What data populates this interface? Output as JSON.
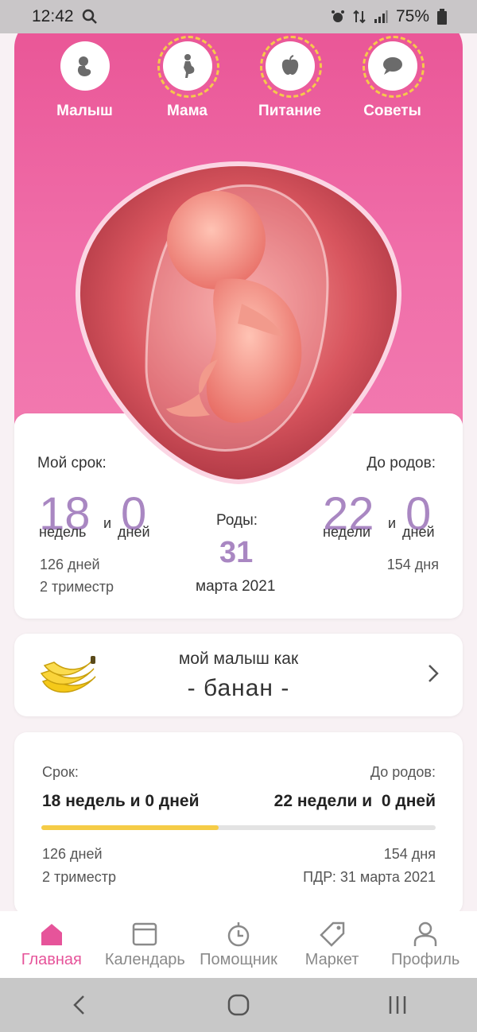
{
  "status_bar": {
    "time": "12:42",
    "battery": "75%"
  },
  "top_nav": [
    {
      "label": "Малыш",
      "icon": "baby-icon"
    },
    {
      "label": "Мама",
      "icon": "mother-icon"
    },
    {
      "label": "Питание",
      "icon": "apple-icon"
    },
    {
      "label": "Советы",
      "icon": "chat-bubble-icon"
    }
  ],
  "term": {
    "my_term_label": "Мой срок:",
    "weeks": "18",
    "weeks_word": "недель",
    "and": "и",
    "days": "0",
    "days_word": "дней",
    "total_days": "126 дней",
    "trimester": "2 триместр",
    "birth_label": "Роды:",
    "birth_day": "31",
    "birth_month": "марта 2021",
    "until_label": "До родов:",
    "until_weeks": "22",
    "until_weeks_word": "недели",
    "until_and": "и",
    "until_days": "0",
    "until_days_word": "дней",
    "until_total_days": "154 дня"
  },
  "size": {
    "line1": "мой малыш как",
    "line2": "- банан -",
    "icon": "banana-icon"
  },
  "progress": {
    "term_label": "Срок:",
    "term_value": "18 недель и 0 дней",
    "until_label": "До родов:",
    "until_value": "22 недели и  0 дней",
    "fraction": 0.45,
    "days": "126 дней",
    "trimester": "2 триместр",
    "until_days": "154 дня",
    "pdr": "ПДР: 31 марта 2021",
    "colors": {
      "fill": "#f5cc47",
      "track": "#e3e3e3"
    }
  },
  "tabs": [
    {
      "label": "Главная",
      "icon": "home-icon",
      "active": true
    },
    {
      "label": "Календарь",
      "icon": "calendar-icon"
    },
    {
      "label": "Помощник",
      "icon": "clock-icon"
    },
    {
      "label": "Маркет",
      "icon": "tag-icon"
    },
    {
      "label": "Профиль",
      "icon": "profile-icon"
    }
  ],
  "colors": {
    "accent": "#e6549a",
    "number": "#a987c2",
    "hero": "#ef65a3"
  }
}
